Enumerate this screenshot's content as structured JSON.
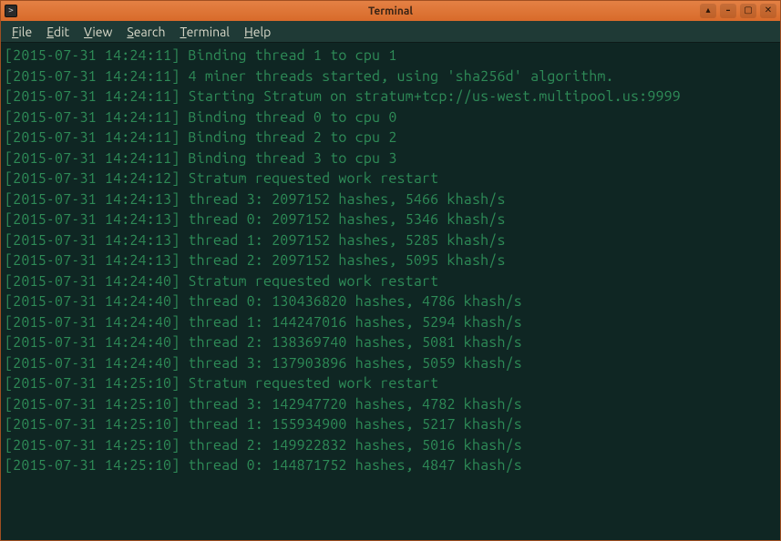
{
  "window": {
    "title": "Terminal"
  },
  "menubar": {
    "file": "File",
    "edit": "Edit",
    "view": "View",
    "search": "Search",
    "terminal": "Terminal",
    "help": "Help"
  },
  "icons": {
    "always_on_top": "▴",
    "minimize": "–",
    "maximize": "▢",
    "close": "✕"
  },
  "log_lines": [
    "[2015-07-31 14:24:11] Binding thread 1 to cpu 1",
    "[2015-07-31 14:24:11] 4 miner threads started, using 'sha256d' algorithm.",
    "[2015-07-31 14:24:11] Starting Stratum on stratum+tcp://us-west.multipool.us:9999",
    "[2015-07-31 14:24:11] Binding thread 0 to cpu 0",
    "[2015-07-31 14:24:11] Binding thread 2 to cpu 2",
    "[2015-07-31 14:24:11] Binding thread 3 to cpu 3",
    "[2015-07-31 14:24:12] Stratum requested work restart",
    "[2015-07-31 14:24:13] thread 3: 2097152 hashes, 5466 khash/s",
    "[2015-07-31 14:24:13] thread 0: 2097152 hashes, 5346 khash/s",
    "[2015-07-31 14:24:13] thread 1: 2097152 hashes, 5285 khash/s",
    "[2015-07-31 14:24:13] thread 2: 2097152 hashes, 5095 khash/s",
    "[2015-07-31 14:24:40] Stratum requested work restart",
    "[2015-07-31 14:24:40] thread 0: 130436820 hashes, 4786 khash/s",
    "[2015-07-31 14:24:40] thread 1: 144247016 hashes, 5294 khash/s",
    "[2015-07-31 14:24:40] thread 2: 138369740 hashes, 5081 khash/s",
    "[2015-07-31 14:24:40] thread 3: 137903896 hashes, 5059 khash/s",
    "[2015-07-31 14:25:10] Stratum requested work restart",
    "[2015-07-31 14:25:10] thread 3: 142947720 hashes, 4782 khash/s",
    "[2015-07-31 14:25:10] thread 1: 155934900 hashes, 5217 khash/s",
    "[2015-07-31 14:25:10] thread 2: 149922832 hashes, 5016 khash/s",
    "[2015-07-31 14:25:10] thread 0: 144871752 hashes, 4847 khash/s"
  ]
}
